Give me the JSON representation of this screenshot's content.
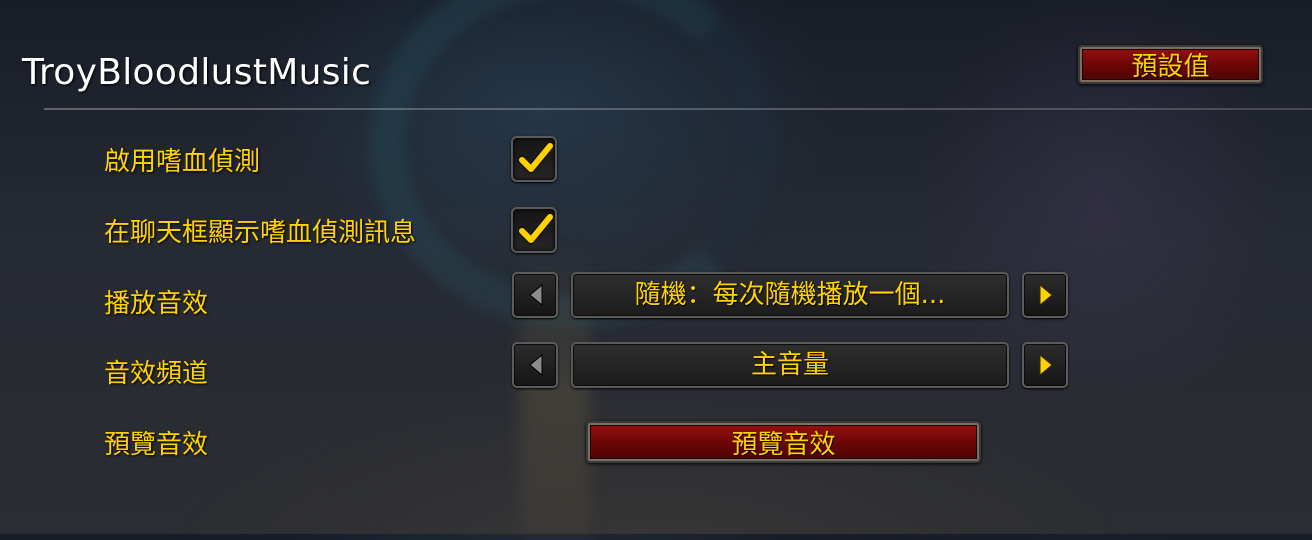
{
  "window": {
    "title": "TroyBloodlustMusic"
  },
  "toolbar": {
    "defaults_label": "預設值"
  },
  "settings": {
    "enable_detection": {
      "label": "啟用嗜血偵測",
      "checked": true
    },
    "chat_message": {
      "label": "在聊天框顯示嗜血偵測訊息",
      "checked": true
    },
    "play_sound": {
      "label": "播放音效",
      "selected": "隨機：每次隨機播放一個..."
    },
    "sound_channel": {
      "label": "音效頻道",
      "selected": "主音量"
    },
    "preview": {
      "label": "預覽音效",
      "button_label": "預覽音效"
    }
  },
  "colors": {
    "label_text": "#ffd200",
    "title_text": "#ffffff",
    "button_red": "#8a0c0c",
    "checkmark": "#ffd200"
  },
  "icons": {
    "checkmark": "checkmark-icon",
    "left_arrow": "arrow-left-icon",
    "right_arrow": "arrow-right-icon"
  }
}
